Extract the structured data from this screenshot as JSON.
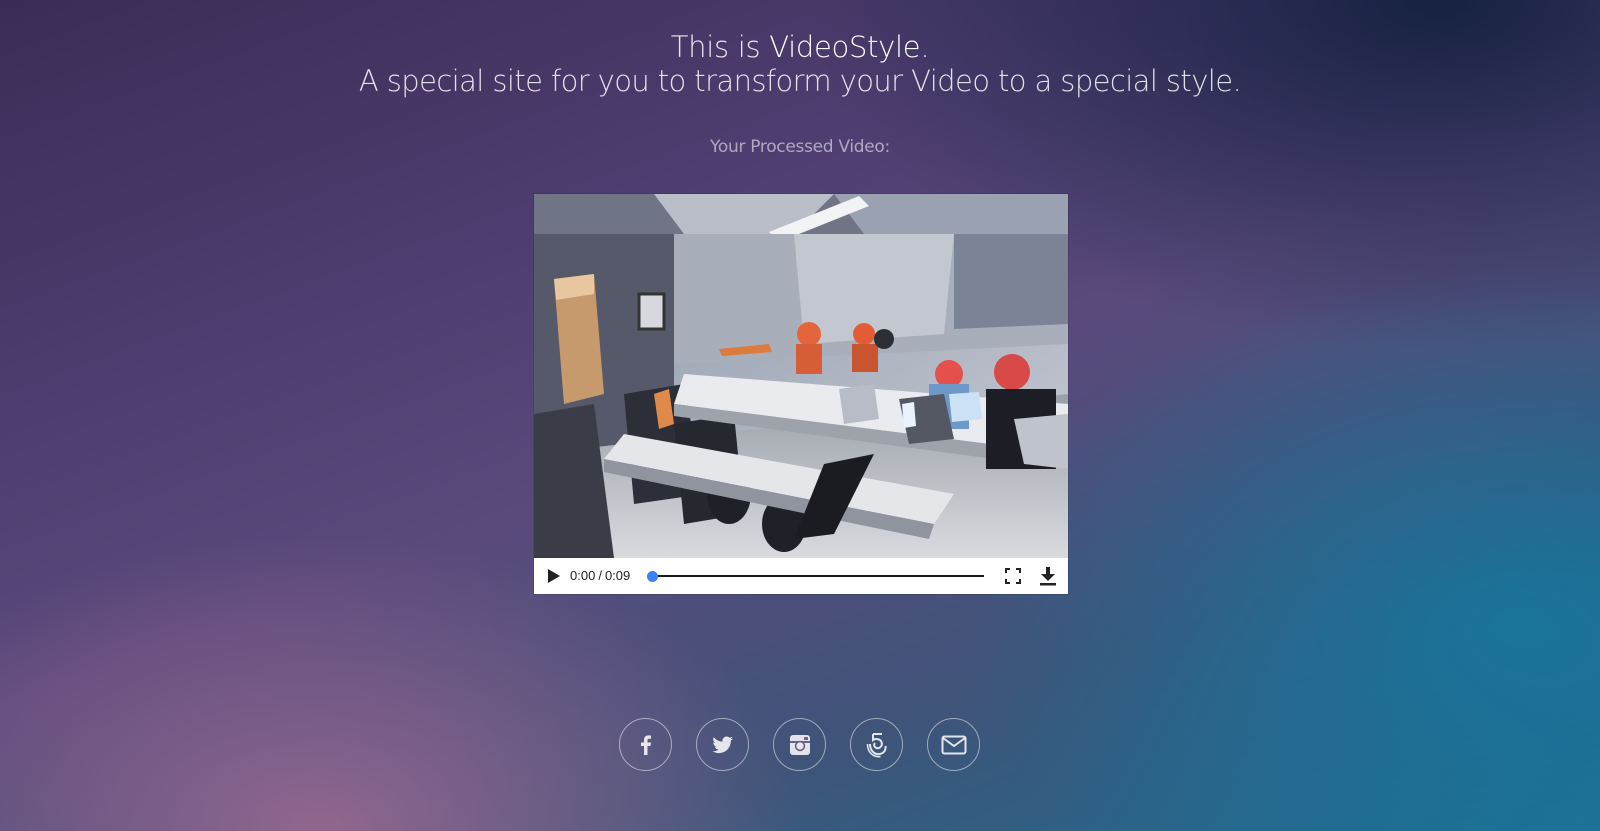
{
  "header": {
    "prefix": "This is ",
    "brand": "VideoStyle",
    "suffix": ".",
    "tagline": "A special site for you to transform your Video to a special style."
  },
  "video_section": {
    "label": "Your Processed Video:"
  },
  "player": {
    "current_time": "0:00",
    "separator": "/",
    "duration": "0:09",
    "progress": 0,
    "accent_color": "#3b82f6",
    "controls": [
      "play-icon",
      "fullscreen-icon",
      "download-icon"
    ]
  },
  "social": {
    "icons": [
      "facebook-icon",
      "twitter-icon",
      "instagram-icon",
      "500px-icon",
      "email-icon"
    ]
  }
}
